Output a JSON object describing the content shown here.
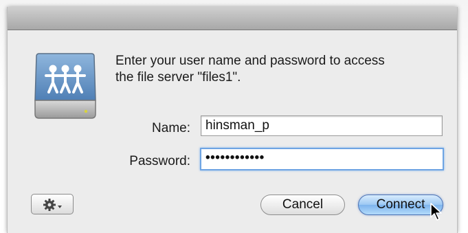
{
  "dialog": {
    "message_line1": "Enter your user name and password to access",
    "message_line2": "the file server \"files1\"."
  },
  "form": {
    "name_label": "Name:",
    "name_value": "hinsman_p",
    "password_label": "Password:",
    "password_mask": "••••••••••••"
  },
  "buttons": {
    "cancel_label": "Cancel",
    "connect_label": "Connect"
  },
  "icons": {
    "server": "file-server-icon",
    "gear": "gear-icon",
    "cursor": "mouse-pointer-icon"
  },
  "colors": {
    "focus_ring": "#6ea4e3",
    "default_button": "#7db4ee",
    "dialog_bg": "#ececec"
  }
}
